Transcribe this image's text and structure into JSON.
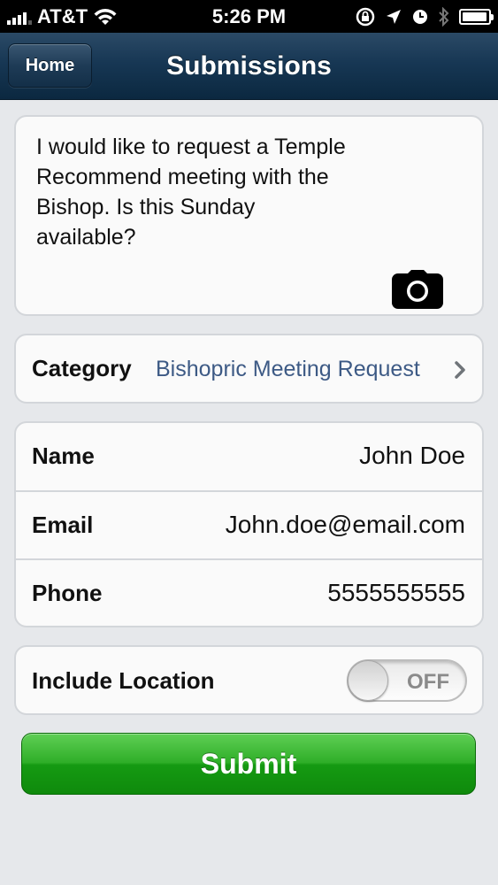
{
  "status_bar": {
    "carrier": "AT&T",
    "time": "5:26 PM",
    "signal_bars": 4,
    "battery_level": 0.95,
    "icons": [
      "signal-icon",
      "wifi-icon",
      "rotation-lock-icon",
      "location-arrow-icon",
      "alarm-clock-icon",
      "bluetooth-icon",
      "battery-icon"
    ]
  },
  "nav": {
    "home_label": "Home",
    "title": "Submissions"
  },
  "message": {
    "text": "I would like to request a Temple\nRecommend meeting with the\nBishop. Is this Sunday\navailable?",
    "attach_icon": "camera-icon"
  },
  "category": {
    "label": "Category",
    "value": "Bishopric Meeting Request",
    "disclosure_icon": "chevron-right-icon"
  },
  "contact": {
    "name_label": "Name",
    "name_value": "John Doe",
    "email_label": "Email",
    "email_value": "John.doe@email.com",
    "phone_label": "Phone",
    "phone_value": "5555555555"
  },
  "location": {
    "label": "Include Location",
    "toggle_state": "OFF"
  },
  "submit": {
    "label": "Submit"
  },
  "colors": {
    "navbar": "#173754",
    "category_value": "#3d5a85",
    "submit_green": "#2fae28",
    "background": "#e6e8eb"
  }
}
